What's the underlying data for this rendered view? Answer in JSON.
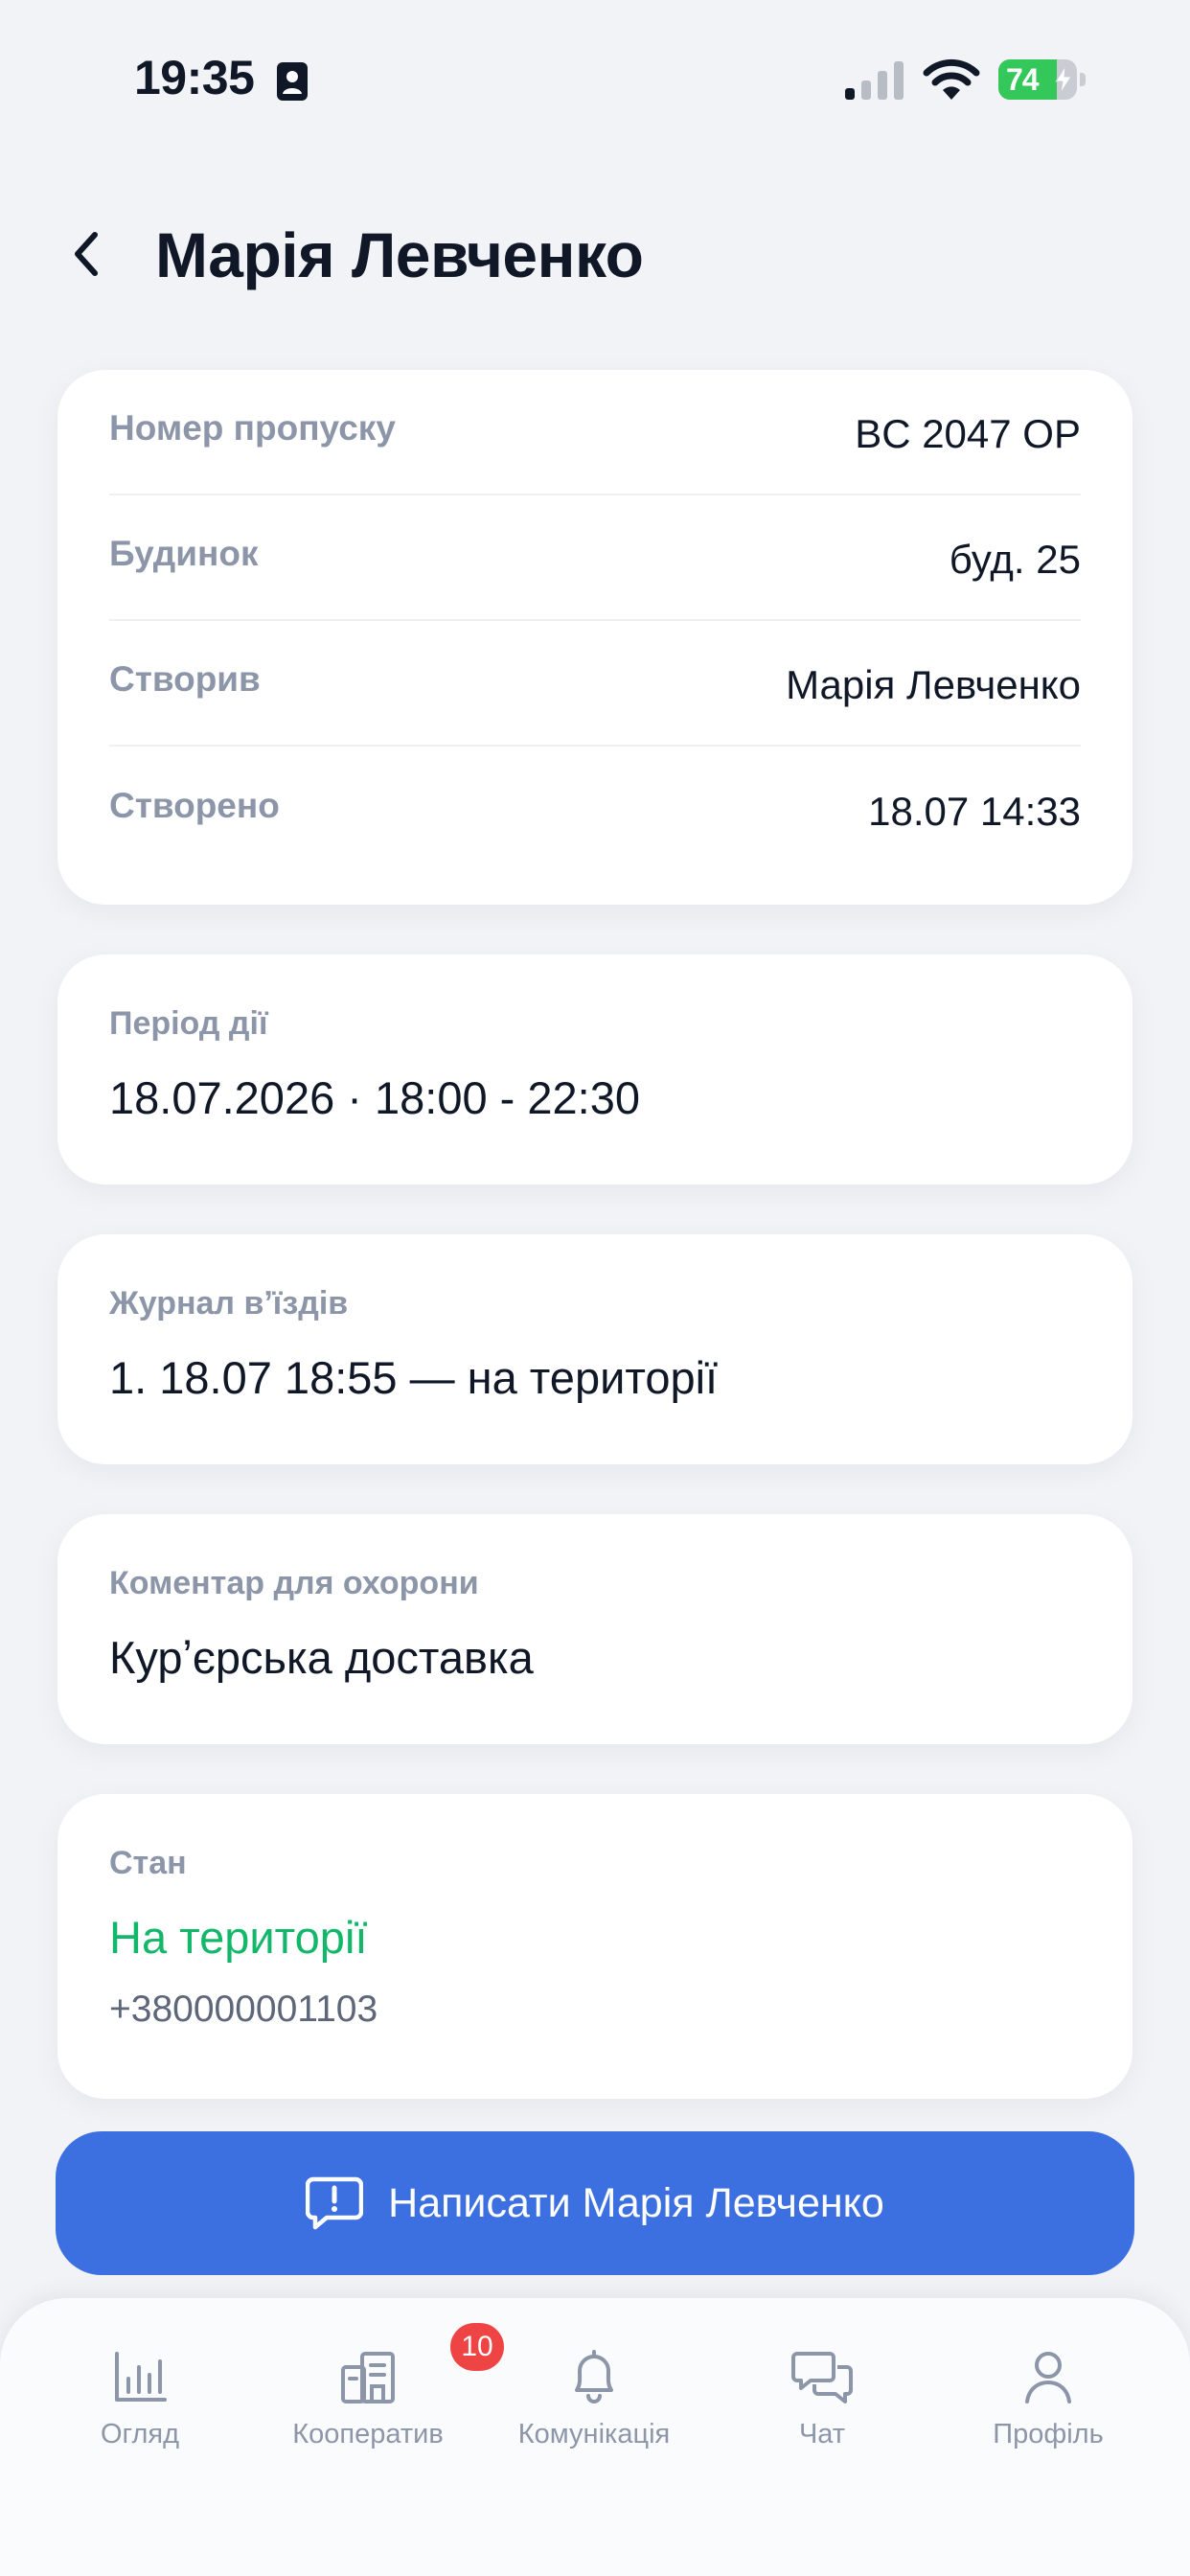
{
  "status_bar": {
    "time": "19:35",
    "battery": "74",
    "battery_level": 0.74
  },
  "header": {
    "title": "Марія Левченко"
  },
  "details": {
    "rows": [
      {
        "label": "Номер пропуску",
        "value": "BC 2047 OP"
      },
      {
        "label": "Будинок",
        "value": "буд. 25"
      },
      {
        "label": "Створив",
        "value": "Марія Левченко"
      },
      {
        "label": "Створено",
        "value": "18.07 14:33"
      }
    ]
  },
  "period": {
    "label": "Період дії",
    "value": "18.07.2026 · 18:00 - 22:30"
  },
  "journal": {
    "label": "Журнал вʼїздів",
    "value": "1. 18.07 18:55 — на території"
  },
  "comment": {
    "label": "Коментар для охорони",
    "value": "Курʼєрська доставка"
  },
  "state": {
    "label": "Стан",
    "value": "На території",
    "phone": "+380000001103",
    "status_color": "#12b76a"
  },
  "action": {
    "label": "Написати Марія Левченко",
    "color": "#3c6fe0"
  },
  "tab_bar": {
    "tabs": [
      {
        "label": "Огляд",
        "icon": "bar-chart-icon"
      },
      {
        "label": "Кооператив",
        "icon": "building-icon",
        "badge": "10"
      },
      {
        "label": "Комунікація",
        "icon": "bell-icon"
      },
      {
        "label": "Чат",
        "icon": "chat-icon"
      },
      {
        "label": "Профіль",
        "icon": "user-icon"
      }
    ]
  }
}
